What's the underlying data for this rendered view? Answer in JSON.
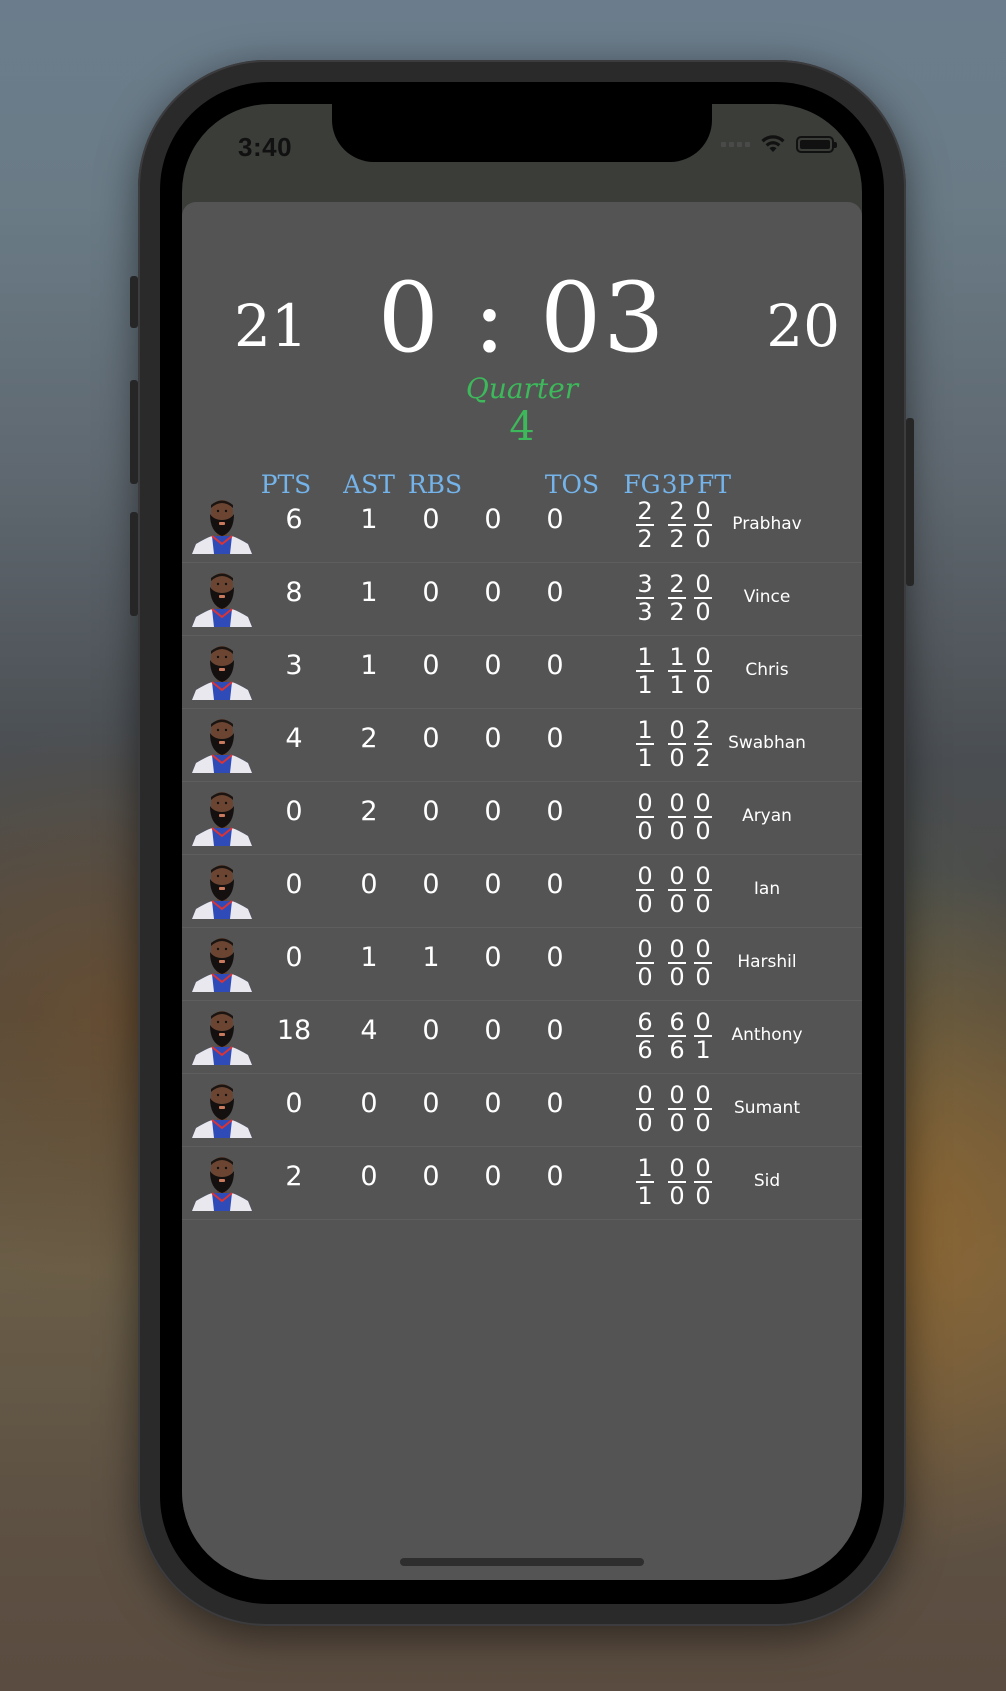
{
  "status_bar": {
    "time": "3:40"
  },
  "scoreboard": {
    "home_score": "21",
    "away_score": "20",
    "clock": "0 : 03",
    "quarter_label": "Quarter",
    "quarter_value": "4"
  },
  "columns": {
    "pts": "PTS",
    "ast": "AST",
    "rbs": "RBS",
    "tos": "TOS",
    "fg": "FG",
    "three": "3P",
    "ft": "FT"
  },
  "players": [
    {
      "name": "Prabhav",
      "pts": "6",
      "ast": "1",
      "rbs": "0",
      "c4": "0",
      "tos": "0",
      "fg_n": "2",
      "fg_d": "2",
      "tp_n": "2",
      "tp_d": "2",
      "ft_n": "0",
      "ft_d": "0"
    },
    {
      "name": "Vince",
      "pts": "8",
      "ast": "1",
      "rbs": "0",
      "c4": "0",
      "tos": "0",
      "fg_n": "3",
      "fg_d": "3",
      "tp_n": "2",
      "tp_d": "2",
      "ft_n": "0",
      "ft_d": "0"
    },
    {
      "name": "Chris",
      "pts": "3",
      "ast": "1",
      "rbs": "0",
      "c4": "0",
      "tos": "0",
      "fg_n": "1",
      "fg_d": "1",
      "tp_n": "1",
      "tp_d": "1",
      "ft_n": "0",
      "ft_d": "0"
    },
    {
      "name": "Swabhan",
      "pts": "4",
      "ast": "2",
      "rbs": "0",
      "c4": "0",
      "tos": "0",
      "fg_n": "1",
      "fg_d": "1",
      "tp_n": "0",
      "tp_d": "0",
      "ft_n": "2",
      "ft_d": "2"
    },
    {
      "name": "Aryan",
      "pts": "0",
      "ast": "2",
      "rbs": "0",
      "c4": "0",
      "tos": "0",
      "fg_n": "0",
      "fg_d": "0",
      "tp_n": "0",
      "tp_d": "0",
      "ft_n": "0",
      "ft_d": "0"
    },
    {
      "name": "Ian",
      "pts": "0",
      "ast": "0",
      "rbs": "0",
      "c4": "0",
      "tos": "0",
      "fg_n": "0",
      "fg_d": "0",
      "tp_n": "0",
      "tp_d": "0",
      "ft_n": "0",
      "ft_d": "0"
    },
    {
      "name": "Harshil",
      "pts": "0",
      "ast": "1",
      "rbs": "1",
      "c4": "0",
      "tos": "0",
      "fg_n": "0",
      "fg_d": "0",
      "tp_n": "0",
      "tp_d": "0",
      "ft_n": "0",
      "ft_d": "0"
    },
    {
      "name": "Anthony",
      "pts": "18",
      "ast": "4",
      "rbs": "0",
      "c4": "0",
      "tos": "0",
      "fg_n": "6",
      "fg_d": "6",
      "tp_n": "6",
      "tp_d": "6",
      "ft_n": "0",
      "ft_d": "1"
    },
    {
      "name": "Sumant",
      "pts": "0",
      "ast": "0",
      "rbs": "0",
      "c4": "0",
      "tos": "0",
      "fg_n": "0",
      "fg_d": "0",
      "tp_n": "0",
      "tp_d": "0",
      "ft_n": "0",
      "ft_d": "0"
    },
    {
      "name": "Sid",
      "pts": "2",
      "ast": "0",
      "rbs": "0",
      "c4": "0",
      "tos": "0",
      "fg_n": "1",
      "fg_d": "1",
      "tp_n": "0",
      "tp_d": "0",
      "ft_n": "0",
      "ft_d": "0"
    }
  ],
  "colors": {
    "sheet": "#545454",
    "header_accent": "#74b4ea",
    "quarter_accent": "#3db85a"
  },
  "icons": {
    "avatar": "player-avatar-icon",
    "wifi": "wifi-icon",
    "battery": "battery-icon"
  }
}
